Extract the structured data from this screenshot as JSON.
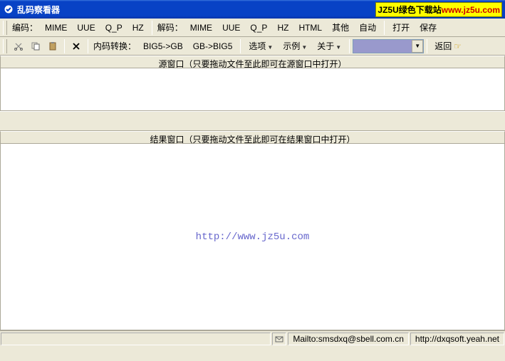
{
  "titlebar": {
    "title": "乱码察看器",
    "ad_prefix": "JZ5U绿色下载站",
    "ad_url": "www.jz5u.com"
  },
  "toolbar1": {
    "encode_label": "编码：",
    "items_a": [
      "MIME",
      "UUE",
      "Q_P",
      "HZ"
    ],
    "decode_label": "解码：",
    "items_b": [
      "MIME",
      "UUE",
      "Q_P",
      "HZ",
      "HTML",
      "其他",
      "自动"
    ],
    "open": "打开",
    "save": "保存"
  },
  "toolbar2": {
    "conv_label": "内码转换：",
    "conv_a": "BIG5->GB",
    "conv_b": "GB->BIG5",
    "options": "选项",
    "samples": "示例",
    "about": "关于",
    "return": "返回"
  },
  "panes": {
    "source_header": "源窗口（只要拖动文件至此即可在源窗口中打开）",
    "result_header": "结果窗口（只要拖动文件至此即可在结果窗口中打开）",
    "result_content": "http://www.jz5u.com"
  },
  "statusbar": {
    "mailto": "Mailto:smsdxq@sbell.com.cn",
    "url": "http://dxqsoft.yeah.net"
  }
}
